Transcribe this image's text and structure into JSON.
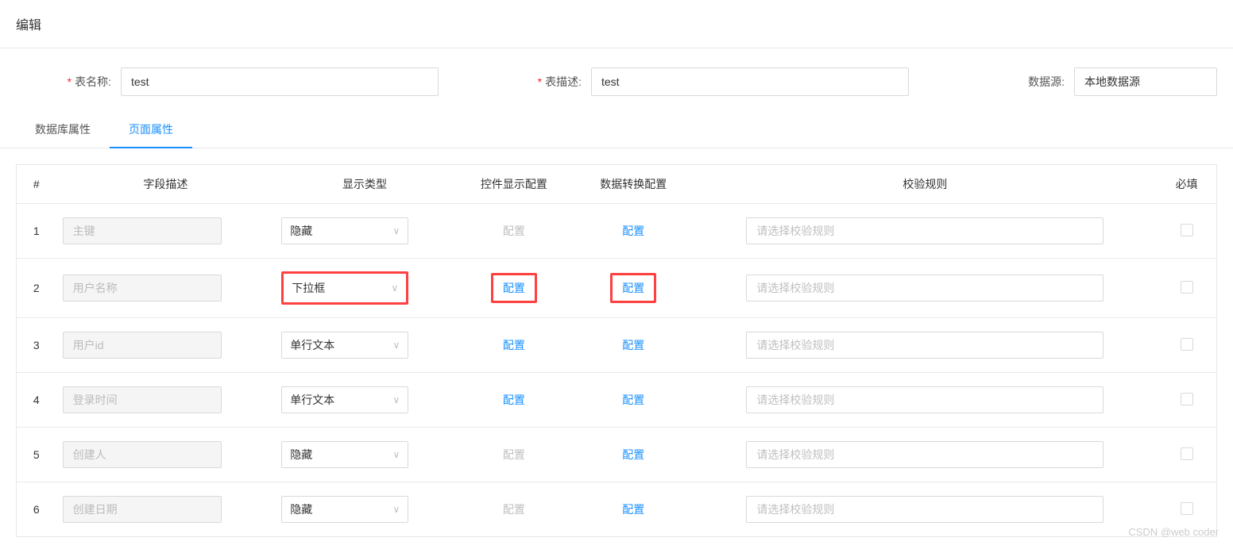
{
  "header": {
    "title": "编辑"
  },
  "form": {
    "table_name_label": "表名称:",
    "table_name_value": "test",
    "table_desc_label": "表描述:",
    "table_desc_value": "test",
    "datasource_label": "数据源:",
    "datasource_value": "本地数据源"
  },
  "tabs": {
    "db": "数据库属性",
    "page": "页面属性"
  },
  "columns": {
    "index": "#",
    "field_desc": "字段描述",
    "display_type": "显示类型",
    "control_config": "控件显示配置",
    "data_transform": "数据转换配置",
    "validation": "校验规则",
    "required": "必填"
  },
  "config_label": "配置",
  "rule_placeholder": "请选择校验规则",
  "rows": [
    {
      "index": "1",
      "desc": "主键",
      "type": "隐藏",
      "config1_enabled": false,
      "config2_enabled": true,
      "highlight": false
    },
    {
      "index": "2",
      "desc": "用户名称",
      "type": "下拉框",
      "config1_enabled": true,
      "config2_enabled": true,
      "highlight": true
    },
    {
      "index": "3",
      "desc": "用户id",
      "type": "单行文本",
      "config1_enabled": true,
      "config2_enabled": true,
      "highlight": false
    },
    {
      "index": "4",
      "desc": "登录时间",
      "type": "单行文本",
      "config1_enabled": true,
      "config2_enabled": true,
      "highlight": false
    },
    {
      "index": "5",
      "desc": "创建人",
      "type": "隐藏",
      "config1_enabled": false,
      "config2_enabled": true,
      "highlight": false
    },
    {
      "index": "6",
      "desc": "创建日期",
      "type": "隐藏",
      "config1_enabled": false,
      "config2_enabled": true,
      "highlight": false
    }
  ],
  "watermark": "CSDN @web coder"
}
